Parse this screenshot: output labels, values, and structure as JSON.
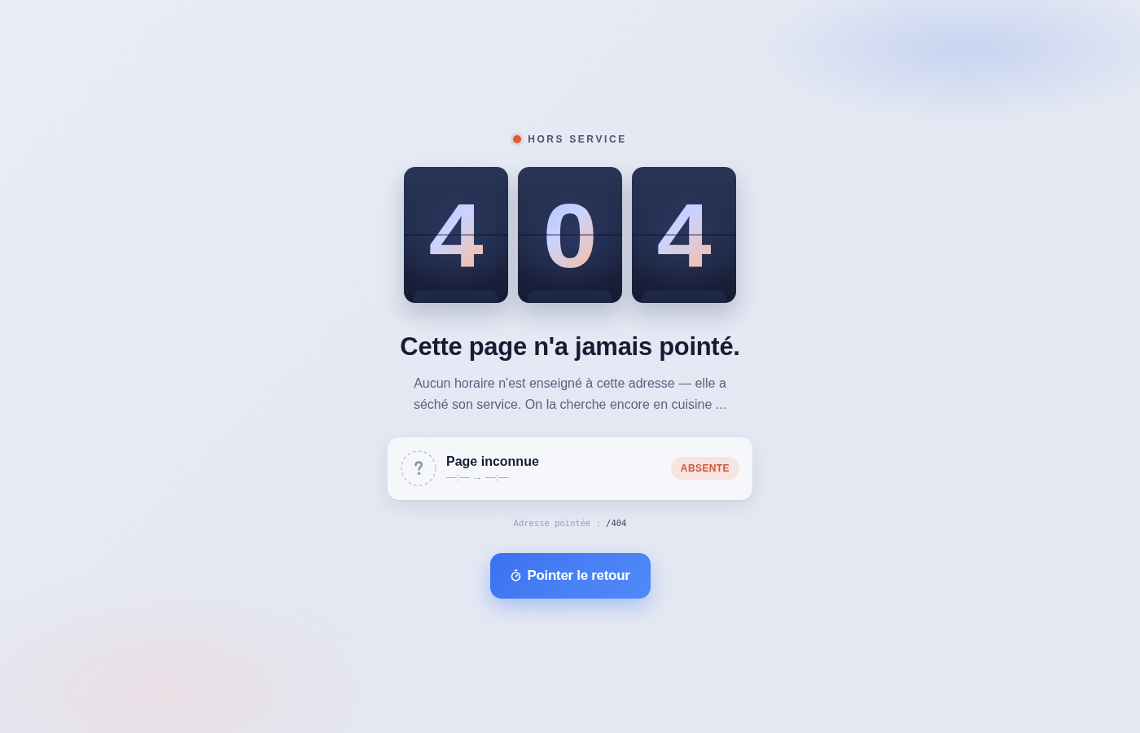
{
  "status": {
    "label": "HORS SERVICE"
  },
  "digits": [
    "4",
    "0",
    "4"
  ],
  "title": "Cette page n'a jamais pointé.",
  "description": "Aucun horaire n'est enseigné à cette adresse — elle a séché son service. On la cherche encore en cuisine ...",
  "entry": {
    "name": "Page inconnue",
    "times": "—:— → —:—",
    "badge": "ABSENTE"
  },
  "address": {
    "label": "Adresse pointée :",
    "value": "/404"
  },
  "button": {
    "label": "Pointer le retour"
  }
}
